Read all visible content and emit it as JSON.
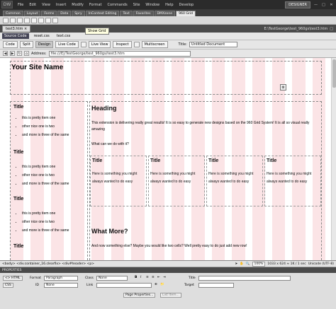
{
  "app": {
    "logo": "DW",
    "workspace": "DESIGNER"
  },
  "menu": [
    "File",
    "Edit",
    "View",
    "Insert",
    "Modify",
    "Format",
    "Commands",
    "Site",
    "Window",
    "Help",
    "Develop"
  ],
  "insert_tabs": {
    "items": [
      "Common",
      "Layout",
      "Forms",
      "Data",
      "Spry",
      "InContext Editing",
      "Text",
      "Favorites",
      "DMXzone",
      "960 Grid"
    ],
    "active": "960 Grid"
  },
  "tooltip": "Show Grid",
  "doc": {
    "tab": "test3.htm",
    "path": "E:\\TestGeorge\\test_960gs\\test3.htm",
    "related": [
      "Source Code",
      "reset.css",
      "text.css"
    ],
    "toolbar": [
      "Code",
      "Split",
      "Design",
      "Live Code",
      "Live View",
      "Inspect",
      "Multiscreen"
    ],
    "active_view": "Design",
    "title_label": "Title:",
    "title_value": "Untitled Document",
    "address_label": "Address:",
    "address_value": "file:///E|/TestGeorge/test_960gs/test3.htm"
  },
  "page": {
    "site_name": "Your Site Name",
    "sidebar": [
      {
        "title": "Title",
        "items": [
          "this is pretty item one",
          "other nice one is two",
          "and more is three of the same"
        ]
      },
      {
        "title": "Title",
        "items": [
          "this is pretty item one",
          "other nice one is two",
          "and more is three of the same"
        ]
      },
      {
        "title": "Title",
        "items": [
          "this is pretty item one",
          "other nice one is two",
          "and more is three of the same"
        ]
      },
      {
        "title": "Title",
        "items": []
      }
    ],
    "main": {
      "heading": "Heading",
      "p1": "This extension is delivering really great results! It is so easy to generate new designs based on the 960 Grid System! It is all so visual really amazing",
      "p2": "What can we do with it?",
      "cells": [
        {
          "title": "Title",
          "text": "Here is something you might always wanted to do easy"
        },
        {
          "title": "Title",
          "text": "Here is something you might always wanted to do easy"
        },
        {
          "title": "Title",
          "text": "Here is something you might always wanted to do easy"
        },
        {
          "title": "Title",
          "text": "Here is something you might always wanted to do easy"
        }
      ],
      "more": "What More?",
      "p3": "And now something else? Maybe you would like two cells? Well pretty easy to do just add new row!"
    }
  },
  "status": {
    "tag_selector": "<body> <div.container_16.clearfix> <div#header> <p>",
    "zoom": "100%",
    "size": "1033 x 624 ≈ 1K / 1 sec",
    "encoding": "Unicode (UTF-8)"
  },
  "properties": {
    "header": "PROPERTIES",
    "html_btn": "<> HTML",
    "css_btn": "CSS",
    "format_label": "Format",
    "format_value": "Paragraph",
    "class_label": "Class",
    "class_value": "None",
    "id_label": "ID",
    "id_value": "None",
    "link_label": "Link",
    "title_label": "Title",
    "target_label": "Target",
    "page_props": "Page Properties...",
    "list_item": "List Item..."
  }
}
